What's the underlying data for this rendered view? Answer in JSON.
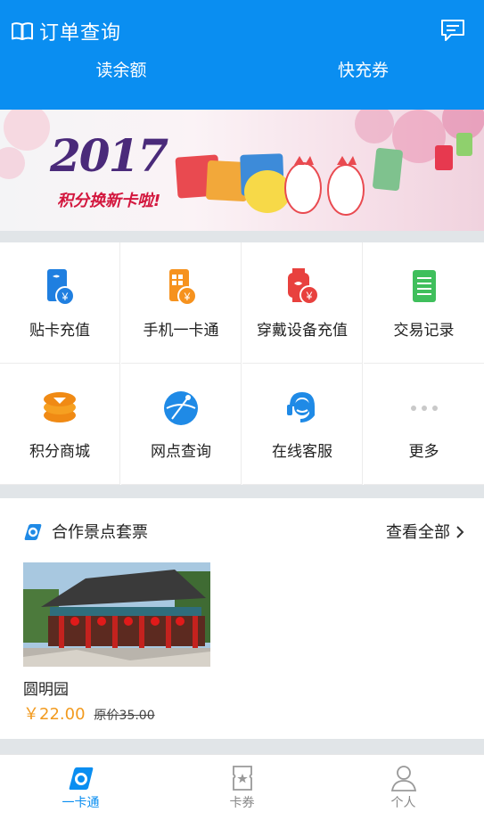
{
  "header": {
    "title": "订单查询",
    "balance_label": "读余额",
    "recharge_label": "快充券"
  },
  "banner": {
    "year_text": "2017",
    "slogan": "积分换新卡啦!"
  },
  "grid": {
    "items": [
      {
        "label": "贴卡充值",
        "icon": "card-recharge-icon"
      },
      {
        "label": "手机一卡通",
        "icon": "phone-card-icon"
      },
      {
        "label": "穿戴设备充值",
        "icon": "watch-recharge-icon"
      },
      {
        "label": "交易记录",
        "icon": "transaction-record-icon"
      },
      {
        "label": "积分商城",
        "icon": "points-mall-icon"
      },
      {
        "label": "网点查询",
        "icon": "outlet-search-icon"
      },
      {
        "label": "在线客服",
        "icon": "customer-service-icon"
      },
      {
        "label": "更多",
        "icon": "more-icon"
      }
    ]
  },
  "section": {
    "title": "合作景点套票",
    "more_label": "查看全部"
  },
  "card": {
    "name": "圆明园",
    "price": "￥22.00",
    "original_price": "原价35.00"
  },
  "tabbar": {
    "tabs": [
      {
        "label": "一卡通",
        "active": true
      },
      {
        "label": "卡券",
        "active": false
      },
      {
        "label": "个人",
        "active": false
      }
    ]
  },
  "colors": {
    "primary": "#0a8ef1",
    "price": "#f29a1e",
    "separator": "#e1e5e8"
  }
}
